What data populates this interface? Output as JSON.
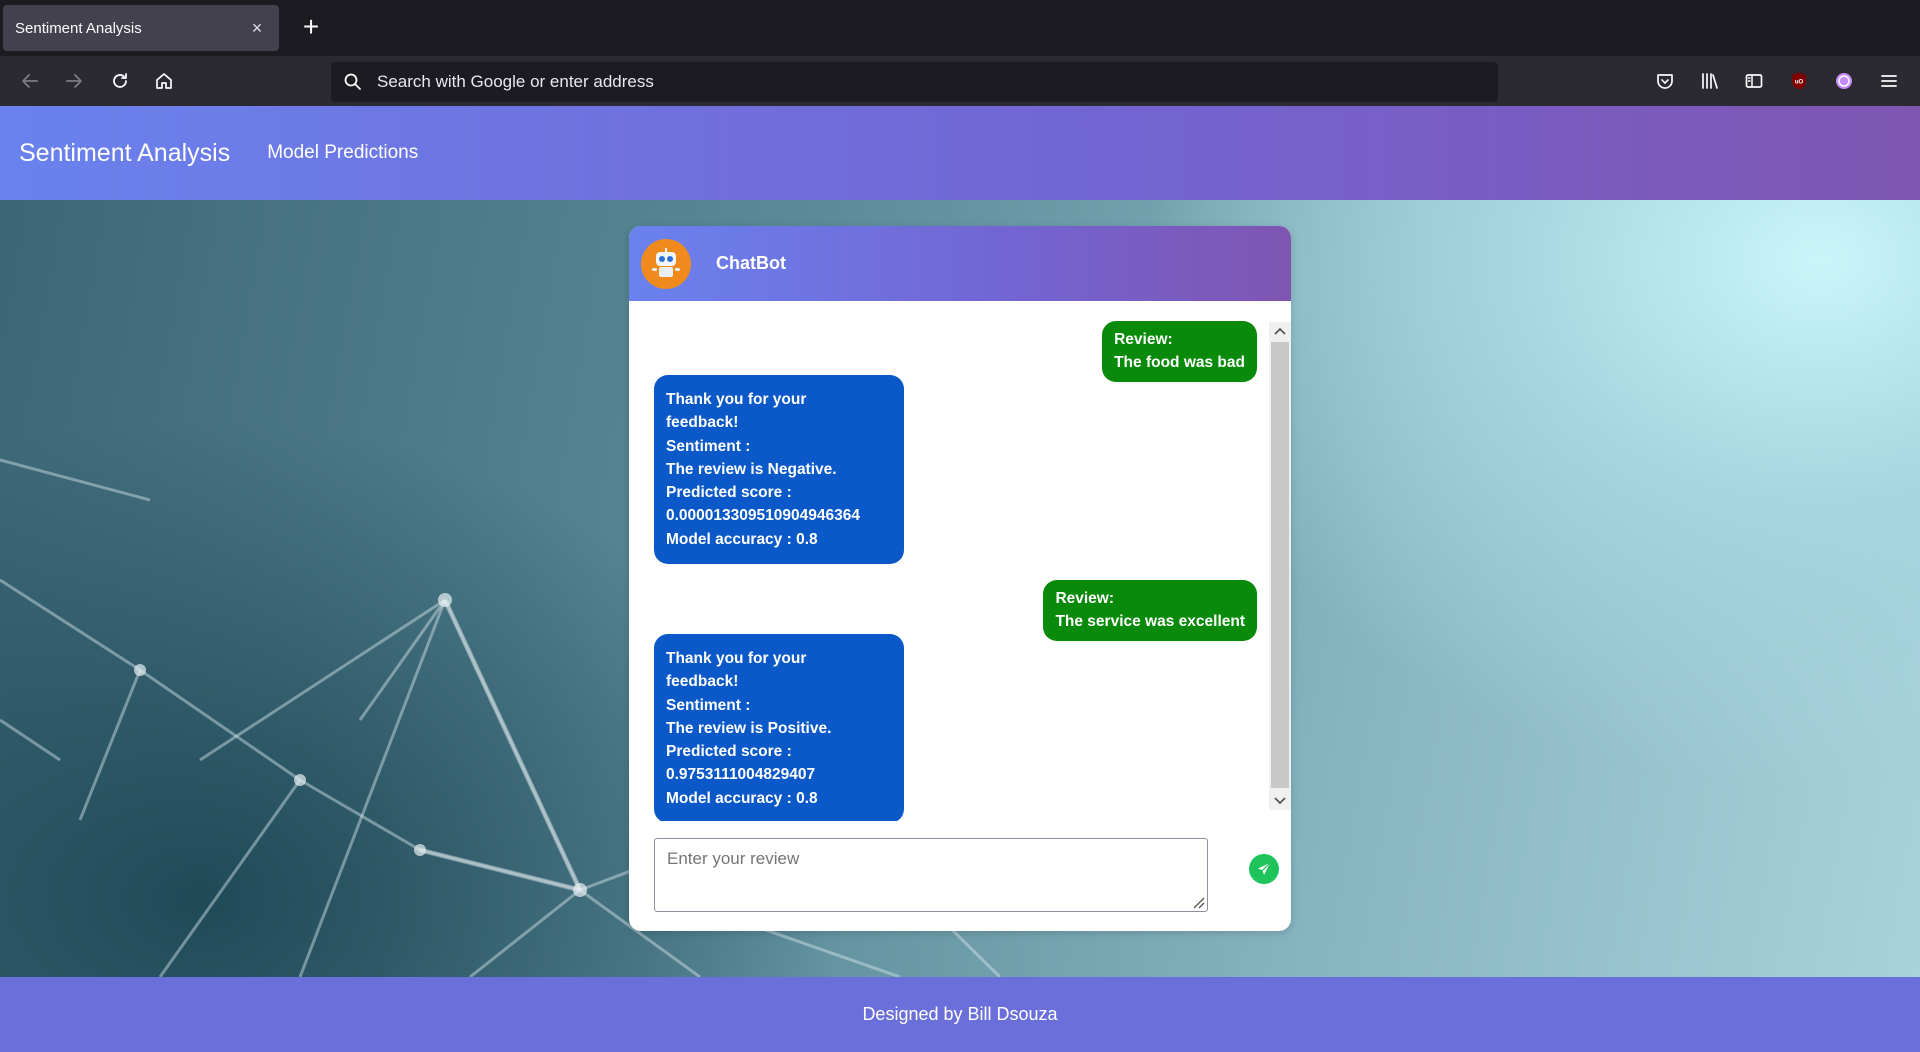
{
  "browser": {
    "tab_title": "Sentiment Analysis",
    "tab_close": "×",
    "new_tab": "+",
    "url_placeholder": "Search with Google or enter address"
  },
  "site": {
    "brand": "Sentiment Analysis",
    "nav_link": "Model Predictions",
    "footer": "Designed by Bill Dsouza"
  },
  "chat": {
    "title": "ChatBot",
    "input_placeholder": "Enter your review",
    "messages": [
      {
        "from": "user",
        "lines": [
          "Review:",
          "The food was bad"
        ]
      },
      {
        "from": "bot",
        "lines": [
          "Thank you for your",
          "feedback!",
          "Sentiment :",
          "The review is Negative.",
          "Predicted score :",
          "0.000013309510904946364",
          "Model accuracy : 0.8"
        ]
      },
      {
        "from": "user",
        "lines": [
          "Review:",
          "The service was excellent"
        ]
      },
      {
        "from": "bot",
        "lines": [
          "Thank you for your",
          "feedback!",
          "Sentiment :",
          "The review is Positive.",
          "Predicted score :",
          "0.9753111004829407",
          "Model accuracy : 0.8"
        ]
      }
    ]
  },
  "colors": {
    "user_bubble": "#0a8a0a",
    "bot_bubble": "#0b59c9",
    "header_gradient_start": "#6a82ee",
    "header_gradient_end": "#7f55b2",
    "footer": "#6b6fd9",
    "send_button": "#1ec45a"
  },
  "icons": [
    "back-arrow-icon",
    "forward-arrow-icon",
    "reload-icon",
    "home-icon",
    "search-icon",
    "pocket-icon",
    "library-icon",
    "sidebar-icon",
    "ublock-icon",
    "account-icon",
    "menu-icon",
    "robot-icon",
    "send-icon"
  ]
}
